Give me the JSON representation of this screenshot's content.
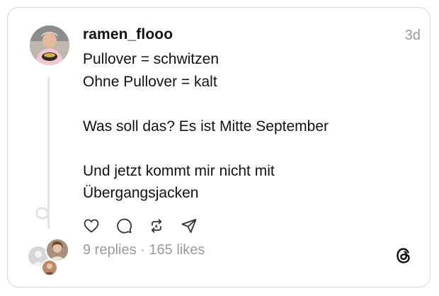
{
  "post": {
    "username": "ramen_flooo",
    "timestamp": "3d",
    "lines": [
      "Pullover = schwitzen",
      "Ohne Pullover = kalt",
      "",
      "Was soll das? Es ist Mitte September",
      "",
      "Und jetzt kommt mir nicht mit",
      "Übergangsjacken"
    ],
    "replies": "9 replies",
    "separator": " · ",
    "likes": "165 likes"
  },
  "icons": {
    "like": "heart-icon",
    "reply": "comment-icon",
    "repost": "repost-icon",
    "share": "send-icon",
    "brand": "threads-logo-icon"
  },
  "colors": {
    "text": "#111111",
    "muted": "#9a9a9a",
    "border": "#d8d8d8",
    "icon": "#333333"
  }
}
